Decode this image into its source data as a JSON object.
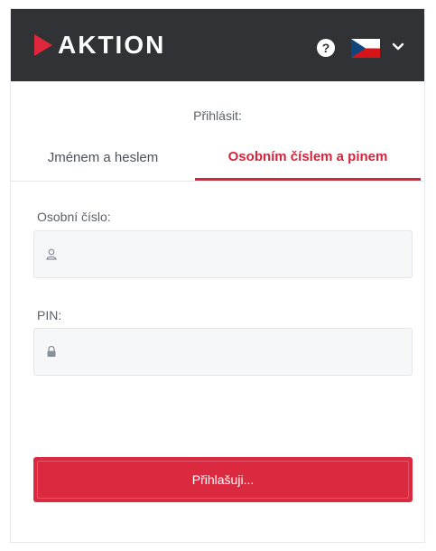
{
  "header": {
    "logo_text": "aktion",
    "help_icon": "?",
    "language_flag": "czech-flag-icon"
  },
  "login": {
    "heading": "Přihlásit:",
    "tabs": [
      {
        "label": "Jménem a heslem",
        "active": false
      },
      {
        "label": "Osobním číslem a pinem",
        "active": true
      }
    ]
  },
  "fields": {
    "personal_number_label": "Osobní číslo:",
    "personal_number_value": "",
    "pin_label": "PIN:",
    "pin_value": ""
  },
  "submit": {
    "label": "Přihlašuji..."
  },
  "colors": {
    "topbar": "#303236",
    "accent": "#db2a40",
    "field_bg": "#f6f7f9"
  }
}
